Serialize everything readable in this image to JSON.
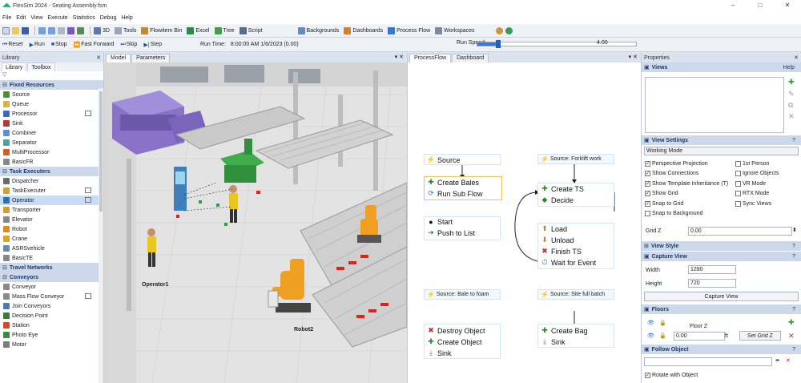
{
  "window": {
    "title": "FlexSim 2024 - Seating Assembly.fsm",
    "controls": [
      "–",
      "□",
      "✕"
    ]
  },
  "menu": [
    "File",
    "Edit",
    "View",
    "Execute",
    "Statistics",
    "Debug",
    "Help"
  ],
  "toolbar": {
    "buttons": [
      "3D",
      "Tools",
      "Flowitem Bin",
      "Excel",
      "Tree",
      "Script"
    ],
    "buttons2": [
      "Backgrounds",
      "Dashboards",
      "Process Flow",
      "Workspaces"
    ]
  },
  "run": {
    "reset": "Reset",
    "run": "Run",
    "stop": "Stop",
    "fast_forward": "Fast Forward",
    "skip": "Skip",
    "step": "Step",
    "run_time_label": "Run Time:",
    "run_time_value": "8:00:00 AM  1/6/2023  (0.00)",
    "speed_label": "Run Speed:",
    "speed_value": "4.00",
    "speed_fraction": 0.13
  },
  "library": {
    "title": "Library",
    "tabs": [
      "Library",
      "Toolbox"
    ],
    "filter": "▽",
    "sections": [
      {
        "name": "Fixed Resources",
        "items": [
          {
            "label": "Source",
            "color": "#4a8f3a"
          },
          {
            "label": "Queue",
            "color": "#d9b24c"
          },
          {
            "label": "Processor",
            "color": "#3a6bbf"
          },
          {
            "label": "Sink",
            "color": "#b03a3a"
          },
          {
            "label": "Combiner",
            "color": "#5b8fd6"
          },
          {
            "label": "Separator",
            "color": "#4fa0a0"
          },
          {
            "label": "MultiProcessor",
            "color": "#c6622a"
          },
          {
            "label": "BasicFR",
            "color": "#888888"
          }
        ]
      },
      {
        "name": "Task Executers",
        "items": [
          {
            "label": "Dispatcher",
            "color": "#6a6a6a"
          },
          {
            "label": "TaskExecuter",
            "color": "#d0a030"
          },
          {
            "label": "Operator",
            "color": "#2f6fb0"
          },
          {
            "label": "Transporter",
            "color": "#d0a030"
          },
          {
            "label": "Elevator",
            "color": "#888888"
          },
          {
            "label": "Robot",
            "color": "#e08a1e"
          },
          {
            "label": "Crane",
            "color": "#e0a020"
          },
          {
            "label": "ASRSvehicle",
            "color": "#6a8ab0"
          },
          {
            "label": "BasicTE",
            "color": "#888888"
          }
        ]
      },
      {
        "name": "Travel Networks",
        "items": []
      },
      {
        "name": "Conveyors",
        "items": [
          {
            "label": "Conveyor",
            "color": "#8a8a8a"
          },
          {
            "label": "Mass Flow Conveyor",
            "color": "#8a8a8a"
          },
          {
            "label": "Join Conveyors",
            "color": "#4a7ab0"
          },
          {
            "label": "Decision Point",
            "color": "#3a7a3a"
          },
          {
            "label": "Station",
            "color": "#d04a2a"
          },
          {
            "label": "Photo Eye",
            "color": "#3a8a3a"
          },
          {
            "label": "Motor",
            "color": "#7a7a7a"
          }
        ]
      }
    ]
  },
  "model": {
    "tabs": [
      "Model",
      "Parameters"
    ],
    "labels": {
      "operator1": "Operator1",
      "robot2": "Robot2"
    }
  },
  "processflow": {
    "tabs": [
      "ProcessFlow",
      "Dashboard"
    ],
    "blocks": {
      "source": "Source",
      "create_bales": "Create Bales",
      "run_sub_flow": "Run Sub Flow",
      "start": "Start",
      "push_to_list": "Push to List",
      "source_foam": "Source: Bale to foam",
      "destroy_object": "Destroy Object",
      "create_object": "Create Object",
      "sink_a": "Sink",
      "source_forklift": "Source: Forklift work",
      "create_ts": "Create TS",
      "decide": "Decide",
      "load": "Load",
      "unload": "Unload",
      "finish_ts": "Finish TS",
      "wait_for_event": "Wait for Event",
      "source_batch": "Source: Site full batch",
      "create_bag": "Create Bag",
      "sink_b": "Sink"
    }
  },
  "properties": {
    "title": "Properties",
    "views_label": "Views",
    "views_help": "Help",
    "view_settings": "View Settings",
    "working_mode": "Working Mode",
    "checkboxes_left": [
      {
        "label": "Perspective Projection",
        "checked": true
      },
      {
        "label": "Show Connections",
        "checked": true
      },
      {
        "label": "Show Template Inheritance (T)",
        "checked": true
      },
      {
        "label": "Show Grid",
        "checked": true
      },
      {
        "label": "Snap to Grid",
        "checked": true
      },
      {
        "label": "Snap to Background",
        "checked": false
      }
    ],
    "checkboxes_right": [
      {
        "label": "1st Person",
        "checked": false
      },
      {
        "label": "Ignore Objects",
        "checked": false
      },
      {
        "label": "VR Mode",
        "checked": false
      },
      {
        "label": "RTX Mode",
        "checked": false
      },
      {
        "label": "Sync Views",
        "checked": false
      }
    ],
    "grid_z_label": "Grid Z",
    "grid_z_value": "0.00",
    "view_style": "View Style",
    "capture_view": "Capture View",
    "width_label": "Width",
    "width_value": "1280",
    "height_label": "Height",
    "height_value": "720",
    "capture_button": "Capture View",
    "floors": "Floors",
    "floor_name": "Floor Z",
    "floor_value": "0.00",
    "floor_unit": "ft",
    "set_grid_z": "Set Grid Z",
    "follow_object": "Follow Object",
    "rotate_with_object": "Rotate with Object"
  }
}
